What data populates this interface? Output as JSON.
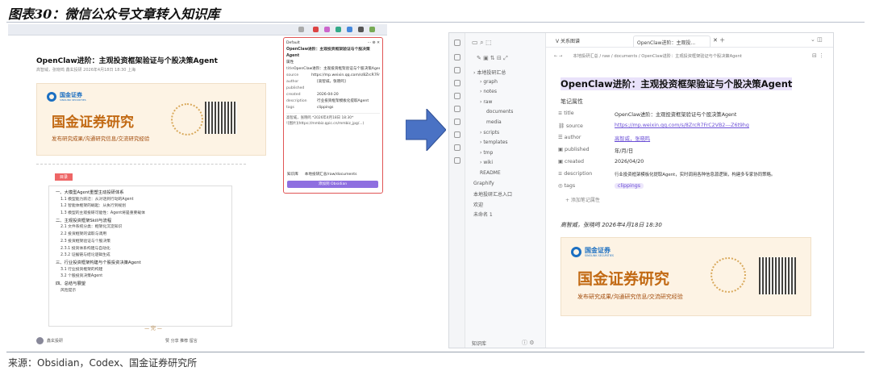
{
  "figure": {
    "title": "图表30：微信公众号文章转入知识库",
    "source": "来源：Obsidian，Codex、国金证券研究所"
  },
  "left": {
    "article_title": "OpenClaw进阶：主观投资框架验证与个股决策Agent",
    "meta": "高智威，张晓鸣  鑫玄投研  2026年4月18日 18:30  上海",
    "banner": {
      "brand": "国金证券",
      "brand_sub": "SINOLINK SECURITIES",
      "big": "国金证券研究",
      "small": "发布研究成果/沟通研究信息/交流研究经验"
    },
    "tag": "目录",
    "toc": [
      "一、大模型Agent重塑主动投研体系",
      "1.1 模型能力跃迁：从对话到行动的Agent",
      "1.2 智能体框架的崛起：从执行到规划",
      "1.3 模型的主观投研可能性：Agent将是重要载体",
      "二、主观投资框架Skill与流程",
      "2.1 文件系统分类：框架化沉淀知识",
      "2.2 投资框架的读取与调用",
      "2.3 投资框架验证与个股决策",
      "2.3.1 投资体系构建与自动化",
      "2.3.2 证据链与结论逻辑生成",
      "三、行业投资框架构建与个股投资决策Agent",
      "3.1 行业投资框架的构建",
      "3.2 个股投资决策Agent",
      "四、总结与展望",
      "风险提示"
    ],
    "end_mark": "— 完 —",
    "footer_left": "鑫玄投研",
    "footer_right": "赞  分享  推荐  留言",
    "clipper": {
      "header": "Default",
      "title": "OpenClaw进阶：主观投资框架验证与个股决策Agent",
      "section": "属性",
      "props": [
        {
          "k": "title",
          "v": "OpenClaw进阶：主观投资框架验证与个股决策Agent"
        },
        {
          "k": "source",
          "v": "https://mp.weixin.qq.com/s/8ZrcR7Fr"
        },
        {
          "k": "author",
          "v": "[高智威，张晓鸣]"
        },
        {
          "k": "published",
          "v": ""
        },
        {
          "k": "created",
          "v": "2026-04-20"
        },
        {
          "k": "description",
          "v": "行业投资框架模板化提取Agent"
        },
        {
          "k": "tags",
          "v": "clippings"
        }
      ],
      "body1": "高智威，张晓鸣 *2026年4月18日 18:30*",
      "body2": "![图片](https://mmbiz.qpic.cn/mmbiz_jpg/...)",
      "vault": "知识库",
      "path": "本地投研汇总/raw/documents",
      "button": "添加到 Obsidian"
    }
  },
  "right": {
    "tabs": {
      "left": "V 关系图谱",
      "active": "OpenClaw进阶：主观投..."
    },
    "breadcrumb": "本地投研汇总 / raw / documents / OpenClaw进阶：主观投资框架验证与个股决策Agent",
    "tree": [
      {
        "label": "本地投研汇总",
        "lvl": 0
      },
      {
        "label": "graph",
        "lvl": 1
      },
      {
        "label": "notes",
        "lvl": 1
      },
      {
        "label": "raw",
        "lvl": 1
      },
      {
        "label": "documents",
        "lvl": 2
      },
      {
        "label": "media",
        "lvl": 2
      },
      {
        "label": "scripts",
        "lvl": 1
      },
      {
        "label": "templates",
        "lvl": 1
      },
      {
        "label": "tmp",
        "lvl": 1
      },
      {
        "label": "wiki",
        "lvl": 1
      },
      {
        "label": "README",
        "lvl": 1
      },
      {
        "label": "Graphify",
        "lvl": 0
      },
      {
        "label": "本地投研汇总入口",
        "lvl": 0
      },
      {
        "label": "欢迎",
        "lvl": 0
      },
      {
        "label": "未命名 1",
        "lvl": 0
      }
    ],
    "tree_bottom": "知识库",
    "note_title": "OpenClaw进阶：主观投资框架验证与个股决策Agent",
    "props_header": "笔记属性",
    "props": [
      {
        "k": "title",
        "v": "OpenClaw进阶：主观投资框架验证与个股决策Agent",
        "t": "plain"
      },
      {
        "k": "source",
        "v": "https://mp.weixin.qq.com/s/8ZrcR7FrC2VB2---Z6t9hg",
        "t": "link"
      },
      {
        "k": "author",
        "v": "高智威，张晓鸣",
        "t": "link"
      },
      {
        "k": "published",
        "v": "年/月/日",
        "t": "plain"
      },
      {
        "k": "created",
        "v": "2026/04/20",
        "t": "plain"
      },
      {
        "k": "description",
        "v": "行业投资框架模板化提取Agent，实时调用各种信息源逻辑，构建多专家协同策略。",
        "t": "plain"
      },
      {
        "k": "tags",
        "v": "clippings",
        "t": "chip"
      }
    ],
    "add_prop": "+ 添加笔记属性",
    "byline": "高智威，张晓鸣 2026年4月18日 18:30",
    "banner": {
      "brand": "国金证券",
      "brand_sub": "SINOLINK SECURITIES",
      "big": "国金证券研究",
      "small": "发布研究成果/沟通研究信息/交流研究经验"
    }
  },
  "colors": {
    "accent": "#8e6fe0",
    "arrow": "#4a72c4",
    "clip_border": "#e05555"
  }
}
